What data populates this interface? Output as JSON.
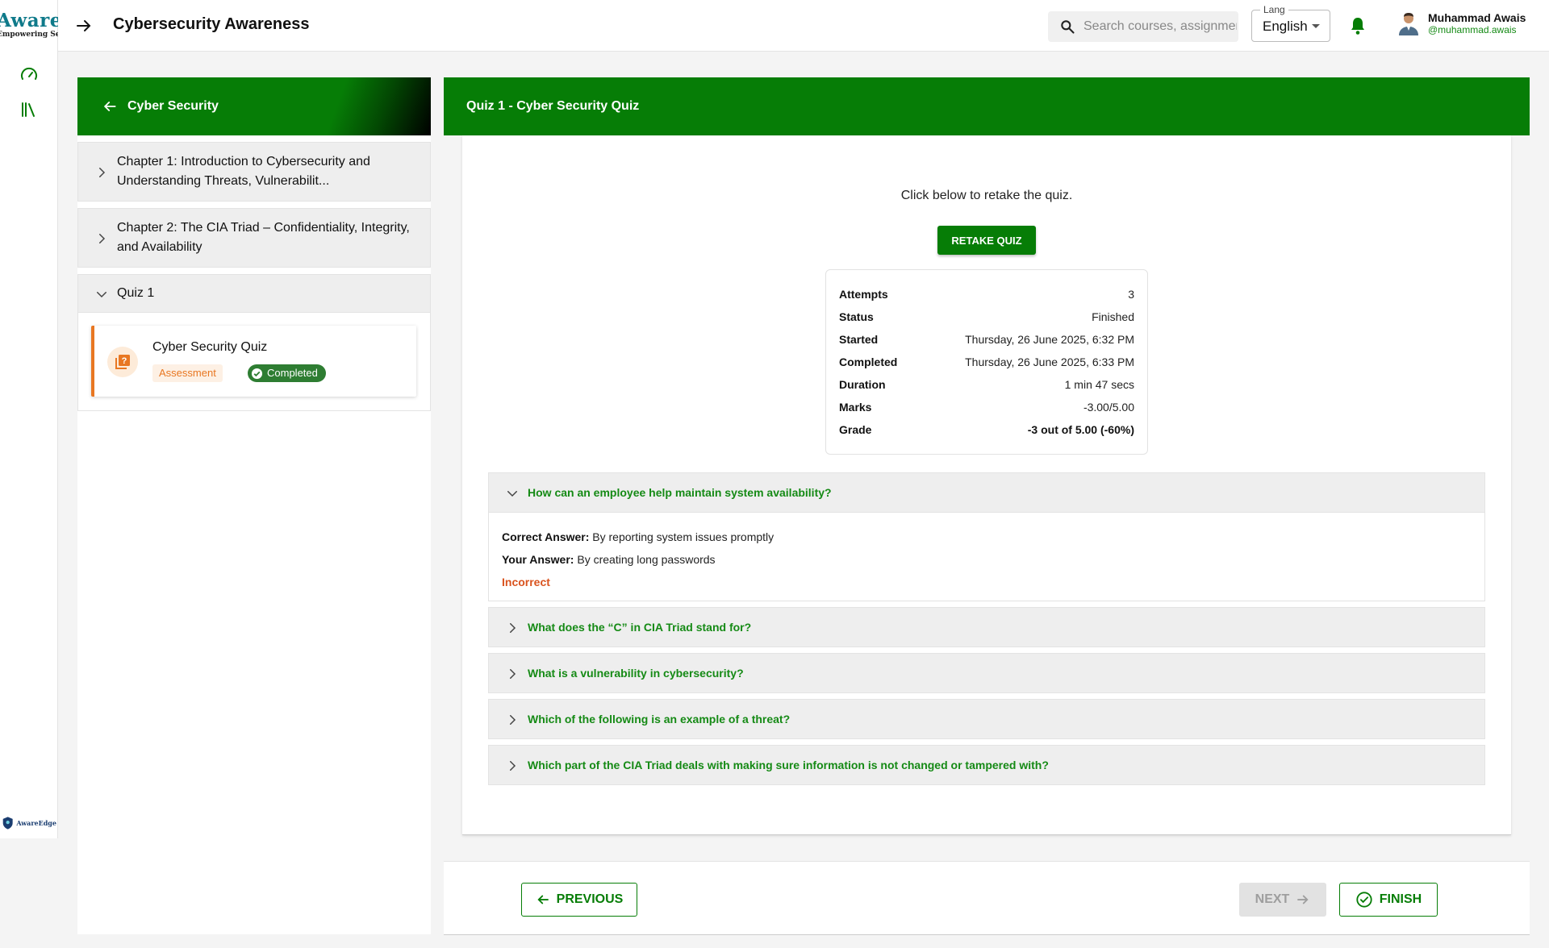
{
  "brand": {
    "logo_text": "AwareEdge",
    "tagline": "Empowering Security",
    "bottom_logo_text": "AwareEdge"
  },
  "header": {
    "title": "Cybersecurity Awareness",
    "search_placeholder": "Search courses, assignments",
    "lang_label": "Lang",
    "lang_value": "English",
    "user_name": "Muhammad Awais",
    "user_handle": "@muhammad.awais"
  },
  "sidebar": {
    "course_title": "Cyber Security",
    "chapters": [
      {
        "label": "Chapter 1: Introduction to Cybersecurity and Understanding Threats, Vulnerabilit..."
      },
      {
        "label": "Chapter 2: The CIA Triad – Confidentiality, Integrity, and Availability"
      }
    ],
    "quiz_group": {
      "label": "Quiz 1",
      "item_title": "Cyber Security Quiz",
      "badge_type": "Assessment",
      "badge_status": "Completed"
    }
  },
  "main": {
    "title": "Quiz 1 - Cyber Security Quiz",
    "retake_text": "Click below to retake the quiz.",
    "retake_button": "RETAKE QUIZ",
    "summary": {
      "attempts_label": "Attempts",
      "attempts": "3",
      "status_label": "Status",
      "status": "Finished",
      "started_label": "Started",
      "started": "Thursday, 26 June 2025, 6:32 PM",
      "completed_label": "Completed",
      "completed": "Thursday, 26 June 2025, 6:33 PM",
      "duration_label": "Duration",
      "duration": "1 min 47 secs",
      "marks_label": "Marks",
      "marks": "-3.00/5.00",
      "grade_label": "Grade",
      "grade": "-3 out of 5.00 (-60%)"
    },
    "questions": [
      {
        "text": "How can an employee help maintain system availability?",
        "correct_label": "Correct Answer:",
        "correct": "By reporting system issues promptly",
        "your_label": "Your Answer:",
        "yours": "By creating long passwords",
        "result": "Incorrect"
      },
      {
        "text": "What does the “C” in CIA Triad stand for?"
      },
      {
        "text": "What is a vulnerability in cybersecurity?"
      },
      {
        "text": "Which of the following is an example of a threat?"
      },
      {
        "text": "Which part of the CIA Triad deals with making sure information is not changed or tampered with?"
      }
    ]
  },
  "footer": {
    "prev_label": "PREVIOUS",
    "next_label": "NEXT",
    "finish_label": "FINISH"
  },
  "colors": {
    "primary_green": "#067d06",
    "link_green": "#158a15",
    "accent_orange": "#e87722",
    "error": "#d9531e"
  }
}
